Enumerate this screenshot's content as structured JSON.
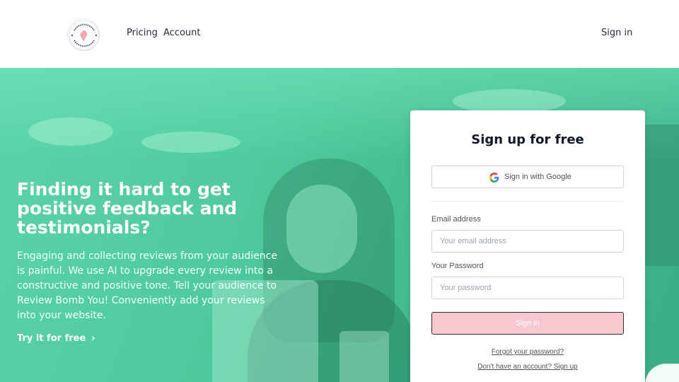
{
  "header": {
    "logo_text_top": "REVIEW BOMB ME",
    "logo_text_bottom": "REVIEW BOMB ME",
    "nav": [
      {
        "label": "Pricing"
      },
      {
        "label": "Account"
      }
    ],
    "sign_in": "Sign in"
  },
  "hero": {
    "title": "Finding it hard to get positive feedback and testimonials?",
    "description": "Engaging and collecting reviews from your audience is painful. We use AI to upgrade every review into a constructive and positive tone. Tell your audience to Review Bomb You! Conveniently add your reviews into your website.",
    "cta": "Try it for free",
    "cta_icon": "chevron-right-icon",
    "colors": {
      "primary": "#4fcb9f"
    }
  },
  "auth_card": {
    "title": "Sign up for free",
    "google_button": "Sign in with Google",
    "email_label": "Email address",
    "email_placeholder": "Your email address",
    "password_label": "Your Password",
    "password_placeholder": "Your password",
    "submit": "Sign in",
    "forgot_link": "Forgot your password?",
    "signup_link": "Don't have an account? Sign up",
    "colors": {
      "submit_bg": "#f6c8cf"
    }
  }
}
